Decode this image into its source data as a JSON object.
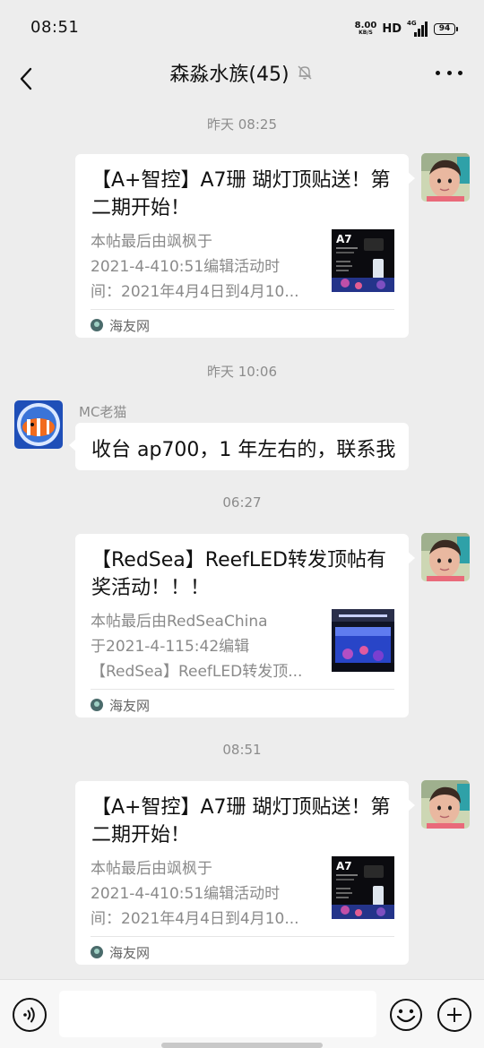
{
  "status_bar": {
    "time": "08:51",
    "net_speed_value": "8.00",
    "net_speed_unit": "KB/S",
    "hd": "HD",
    "network": "4G",
    "battery": "94"
  },
  "header": {
    "title": "森淼水族(45)",
    "back_icon": "back-arrow-icon",
    "mute_icon": "bell-off-icon",
    "more_icon": "more-dots-icon"
  },
  "messages": [
    {
      "timestamp": "昨天 08:25",
      "title_line1": "【A+智控】A7珊 瑚灯顶贴送！第",
      "title_line2": "二期开始！",
      "desc_line1": "本帖最后由飒枫于",
      "desc_line2": "2021-4-410:51编辑活动时",
      "desc_line3": "间：2021年4月4日到4月10...",
      "thumb_label": "A7",
      "source": "海友网"
    },
    {
      "timestamp": "昨天 10:06",
      "sender": "MC老猫",
      "text": "收台 ap700，1 年左右的，联系我"
    },
    {
      "timestamp": "06:27",
      "title_line1": "【RedSea】ReefLED转发顶帖有",
      "title_line2": "奖活动！！！",
      "desc_line1": "本帖最后由RedSeaChina",
      "desc_line2": "于2021-4-115:42编辑",
      "desc_line3": "【RedSea】ReefLED转发顶...",
      "source": "海友网"
    },
    {
      "timestamp": "08:51",
      "title_line1": "【A+智控】A7珊 瑚灯顶贴送！第",
      "title_line2": "二期开始！",
      "desc_line1": "本帖最后由飒枫于",
      "desc_line2": "2021-4-410:51编辑活动时",
      "desc_line3": "间：2021年4月4日到4月10...",
      "thumb_label": "A7",
      "source": "海友网"
    }
  ],
  "input_bar": {
    "placeholder": "",
    "voice_icon": "voice-icon",
    "emoji_icon": "emoji-icon",
    "plus_icon": "plus-icon"
  },
  "colors": {
    "background": "#ededed",
    "bubble": "#ffffff",
    "meta_text": "#8c8c8c"
  }
}
